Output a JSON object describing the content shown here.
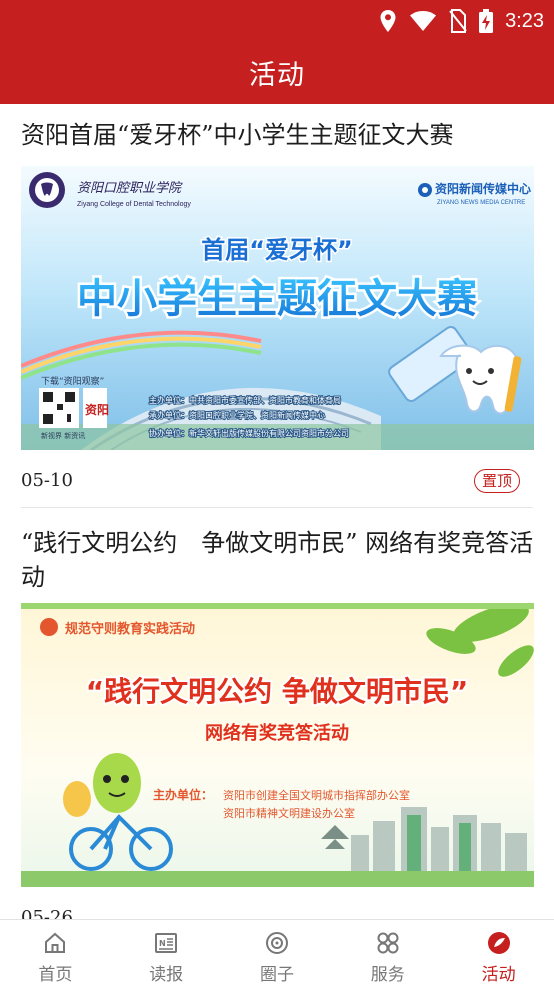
{
  "status_bar": {
    "time": "3:23",
    "icons": [
      "location-icon",
      "wifi-icon",
      "no-sim-icon",
      "battery-charging-icon"
    ]
  },
  "header": {
    "title": "活动"
  },
  "articles": [
    {
      "title": "资阳首届“爱牙杯”中小学生主题征文大赛",
      "date": "05-10",
      "badge": "置顶",
      "banner": {
        "org_cn": "资阳口腔职业学院",
        "org_en": "Ziyang College of Dental Technology",
        "media_cn": "资阳新闻传媒中心",
        "media_en": "ZIYANG NEWS MEDIA CENTRE",
        "subtitle": "首届“爱牙杯”",
        "headline": "中小学生主题征文大赛",
        "download": "下载“资阳观察”",
        "app_slogan": "新视界 新资讯",
        "app_logo_text": "资阳",
        "lines": [
          "主办单位：中共资阳市委宣传部、资阳市教育和体育局",
          "承办单位：资阳口腔职业学院、资阳新闻传媒中心",
          "协办单位：新华文轩出版传媒股份有限公司资阳市分公司"
        ]
      }
    },
    {
      "title": "“践行文明公约　争做文明市民” 网络有奖竞答活动",
      "date": "05-26",
      "banner": {
        "tag": "规范守则教育实践活动",
        "headline": "“践行文明公约  争做文明市民”",
        "subtitle": "网络有奖竞答活动",
        "host_label": "主办单位：",
        "hosts": [
          "资阳市创建全国文明城市指挥部办公室",
          "资阳市精神文明建设办公室"
        ]
      }
    }
  ],
  "tabs": [
    {
      "label": "首页",
      "icon": "home-icon",
      "active": false
    },
    {
      "label": "读报",
      "icon": "newspaper-icon",
      "active": false
    },
    {
      "label": "圈子",
      "icon": "circle-icon",
      "active": false
    },
    {
      "label": "服务",
      "icon": "services-grid-icon",
      "active": false
    },
    {
      "label": "活动",
      "icon": "activity-icon",
      "active": true
    }
  ],
  "colors": {
    "brand_red": "#c5201f",
    "tab_inactive": "#777777"
  }
}
